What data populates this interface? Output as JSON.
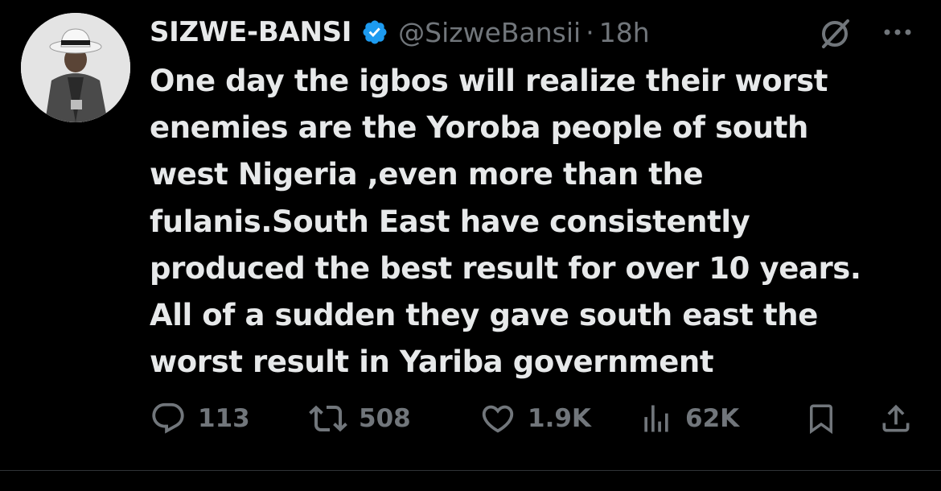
{
  "author": {
    "display_name": "SIZWE-BANSI",
    "handle": "@SizweBansii",
    "separator": "·",
    "timestamp": "18h",
    "verified": true,
    "avatar_icon": "avatar-photo"
  },
  "tweet": {
    "lines": [
      "One day the igbos will realize their worst",
      "enemies are the Yoroba people of south",
      "west Nigeria ,even more than the",
      "fulanis.South East have consistently",
      "produced the best result for over 10 years.",
      "All of a sudden they gave south east the",
      "worst result in Yariba government"
    ]
  },
  "actions": {
    "reply_count": "113",
    "repost_count": "508",
    "like_count": "1.9K",
    "views_count": "62K"
  },
  "icons": {
    "verified": "verified-badge-icon",
    "grok": "grok-icon",
    "more": "more-icon",
    "reply": "reply-icon",
    "repost": "repost-icon",
    "like": "like-icon",
    "views": "views-icon",
    "bookmark": "bookmark-icon",
    "share": "share-icon"
  },
  "colors": {
    "background": "#000000",
    "text_primary": "#e7e9ea",
    "text_secondary": "#71767b",
    "verified_blue": "#1d9bf0",
    "divider": "#2f3336"
  }
}
